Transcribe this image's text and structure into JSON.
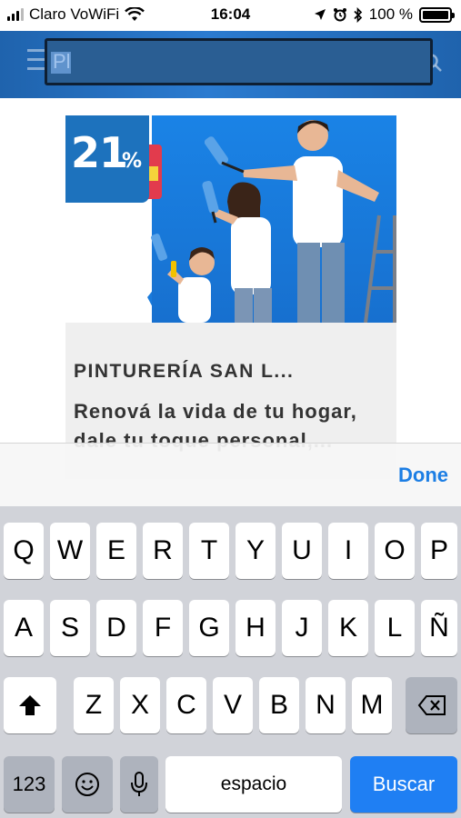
{
  "status_bar": {
    "carrier": "Claro VoWiFi",
    "time": "16:04",
    "battery": "100 %"
  },
  "header": {
    "search_value": "Pl"
  },
  "card": {
    "discount": "21",
    "discount_symbol": "%",
    "title": "PINTURERÍA SAN L...",
    "description": "Renová la vida de tu hogar, dale tu toque personal,..."
  },
  "keyboard": {
    "done_label": "Done",
    "row1": [
      "Q",
      "W",
      "E",
      "R",
      "T",
      "Y",
      "U",
      "I",
      "O",
      "P"
    ],
    "row2": [
      "A",
      "S",
      "D",
      "F",
      "G",
      "H",
      "J",
      "K",
      "L",
      "Ñ"
    ],
    "row3": [
      "Z",
      "X",
      "C",
      "V",
      "B",
      "N",
      "M"
    ],
    "numbers_label": "123",
    "space_label": "espacio",
    "go_label": "Buscar"
  },
  "colors": {
    "header_blue": "#2b7bd0",
    "badge_blue": "#1d72bd",
    "ios_blue": "#1c7ee4",
    "go_key": "#1f7ff3"
  }
}
